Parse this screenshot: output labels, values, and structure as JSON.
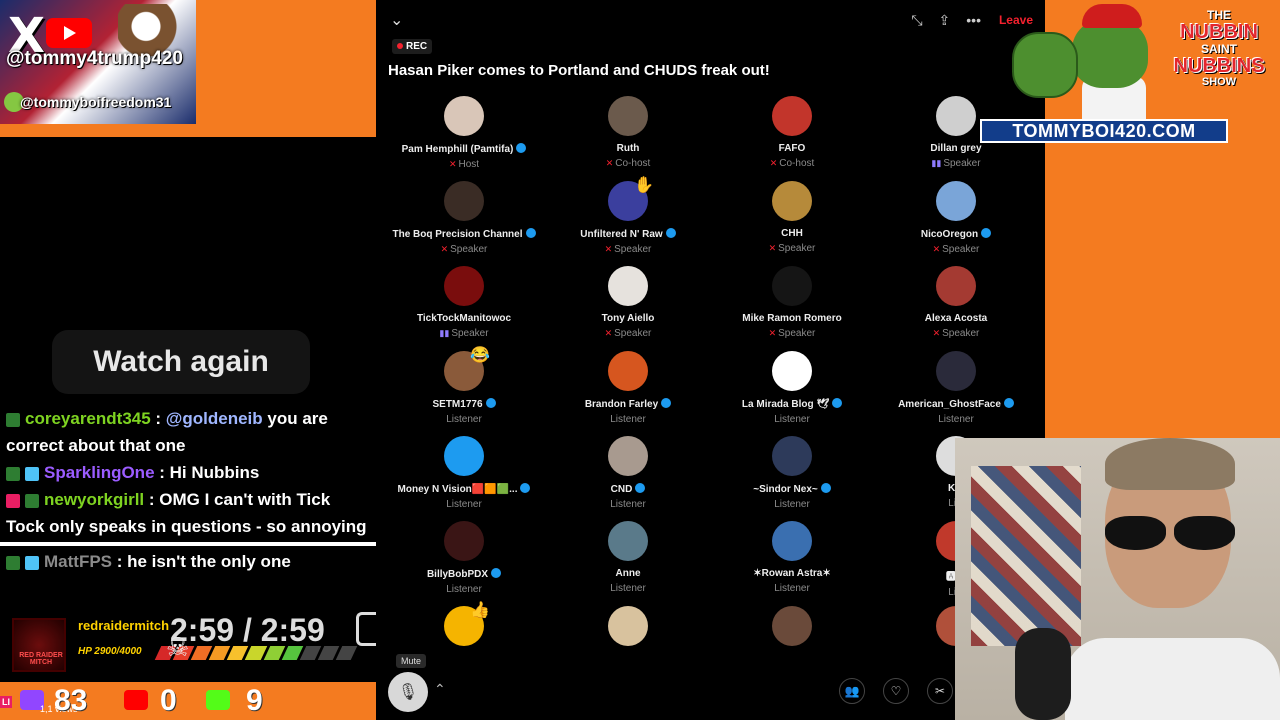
{
  "branding": {
    "x_handle": "@tommy4trump420",
    "rumble_handle": "@tommyboifreedom31",
    "site": "TOMMYBOI420.COM",
    "show_logo": {
      "line1": "THE",
      "line2": "NUBBIN",
      "line3": "SAINT",
      "line4": "NUBBINS",
      "line5": "SHOW"
    },
    "colors": {
      "orange": "#f47b20",
      "banner_blue": "#123d8a"
    }
  },
  "replay": {
    "watch_again_label": "Watch again",
    "time": "2:59 / 2:59"
  },
  "chat": {
    "messages": [
      {
        "user": "coreyarendt345",
        "mention": "@goldeneib",
        "text": " you are correct about that one"
      },
      {
        "user": "SparklingOne",
        "text": ": Hi Nubbins"
      },
      {
        "user": "newyorkgirll",
        "text": ": OMG I can't with Tick Tock only speaks in questions - so annoying"
      },
      {
        "user": "MattFPS",
        "text": ": he isn't the only one"
      }
    ]
  },
  "alert": {
    "user": "redraidermitch",
    "avatar_label": "RED RAIDER MITCH",
    "hp": "HP 2900/4000",
    "hp_fraction": 0.725
  },
  "stats": {
    "live_tag": "LI",
    "views": "1,1 views",
    "twitch_count": "83",
    "youtube_count": "0",
    "kick_count": "9"
  },
  "space": {
    "rec_label": "REC",
    "title": "Hasan Piker comes to Portland and CHUDS freak out!",
    "leave_label": "Leave",
    "mute_tooltip": "Mute",
    "participants": [
      {
        "name": "Pam Hemphill (Pamtifa)",
        "role": "Host",
        "verified": true,
        "muted": true,
        "color": "#d9c6b8"
      },
      {
        "name": "Ruth",
        "role": "Co-host",
        "verified": false,
        "muted": true,
        "color": "#6b5a4c"
      },
      {
        "name": "FAFO",
        "role": "Co-host",
        "verified": false,
        "muted": true,
        "color": "#c2352b"
      },
      {
        "name": "Dillan grey",
        "role": "Speaker",
        "verified": false,
        "speaking": true,
        "color": "#cfcfcf"
      },
      {
        "name": "The Boq Precision Channel",
        "role": "Speaker",
        "verified": true,
        "muted": true,
        "color": "#3a2c25"
      },
      {
        "name": "Unfiltered N' Raw",
        "role": "Speaker",
        "verified": true,
        "muted": true,
        "color": "#3b3f9e",
        "emoji": "✋"
      },
      {
        "name": "CHH",
        "role": "Speaker",
        "verified": false,
        "muted": true,
        "color": "#b68a3a"
      },
      {
        "name": "NicoOregon",
        "role": "Speaker",
        "verified": true,
        "muted": true,
        "color": "#7aa5d8"
      },
      {
        "name": "TickTockManitowoc",
        "role": "Speaker",
        "verified": false,
        "speaking": true,
        "color": "#7a0d0d"
      },
      {
        "name": "Tony Aiello",
        "role": "Speaker",
        "verified": false,
        "muted": true,
        "color": "#e6e2dd"
      },
      {
        "name": "Mike Ramon Romero",
        "role": "Speaker",
        "verified": false,
        "muted": true,
        "color": "#151515"
      },
      {
        "name": "Alexa Acosta",
        "role": "Speaker",
        "verified": false,
        "muted": true,
        "color": "#a43a32"
      },
      {
        "name": "SETM1776",
        "role": "Listener",
        "verified": true,
        "color": "#8a5a3a",
        "emoji": "😂"
      },
      {
        "name": "Brandon Farley",
        "role": "Listener",
        "verified": true,
        "color": "#d6561f"
      },
      {
        "name": "La Mirada Blog 🕊",
        "role": "Listener",
        "verified": true,
        "color": "#ffffff"
      },
      {
        "name": "American_GhostFace",
        "role": "Listener",
        "verified": true,
        "color": "#2a2a3a"
      },
      {
        "name": "Money N Vision🟥🟧🟩...",
        "role": "Listener",
        "verified": true,
        "color": "#1d9bf0"
      },
      {
        "name": "CND",
        "role": "Listener",
        "verified": true,
        "color": "#a89a8f"
      },
      {
        "name": "~Sindor Nex~",
        "role": "Listener",
        "verified": true,
        "color": "#2d3a5a"
      },
      {
        "name": "Kin",
        "role": "List",
        "verified": false,
        "color": "#dddddd"
      },
      {
        "name": "BillyBobPDX",
        "role": "Listener",
        "verified": true,
        "color": "#3a1515"
      },
      {
        "name": "Anne",
        "role": "Listener",
        "verified": false,
        "color": "#5a7a8a"
      },
      {
        "name": "✶Rowan Astra✶",
        "role": "Listener",
        "verified": false,
        "color": "#3a6fb0"
      },
      {
        "name": "🅰🅰",
        "role": "List",
        "verified": false,
        "color": "#c0392b"
      },
      {
        "name": "",
        "role": "",
        "color": "#f5b400",
        "emoji": "👍"
      },
      {
        "name": "",
        "role": "",
        "color": "#d8c29e"
      },
      {
        "name": "",
        "role": "",
        "color": "#6a4a3a"
      },
      {
        "name": "",
        "role": "",
        "color": "#b0503a"
      }
    ]
  }
}
